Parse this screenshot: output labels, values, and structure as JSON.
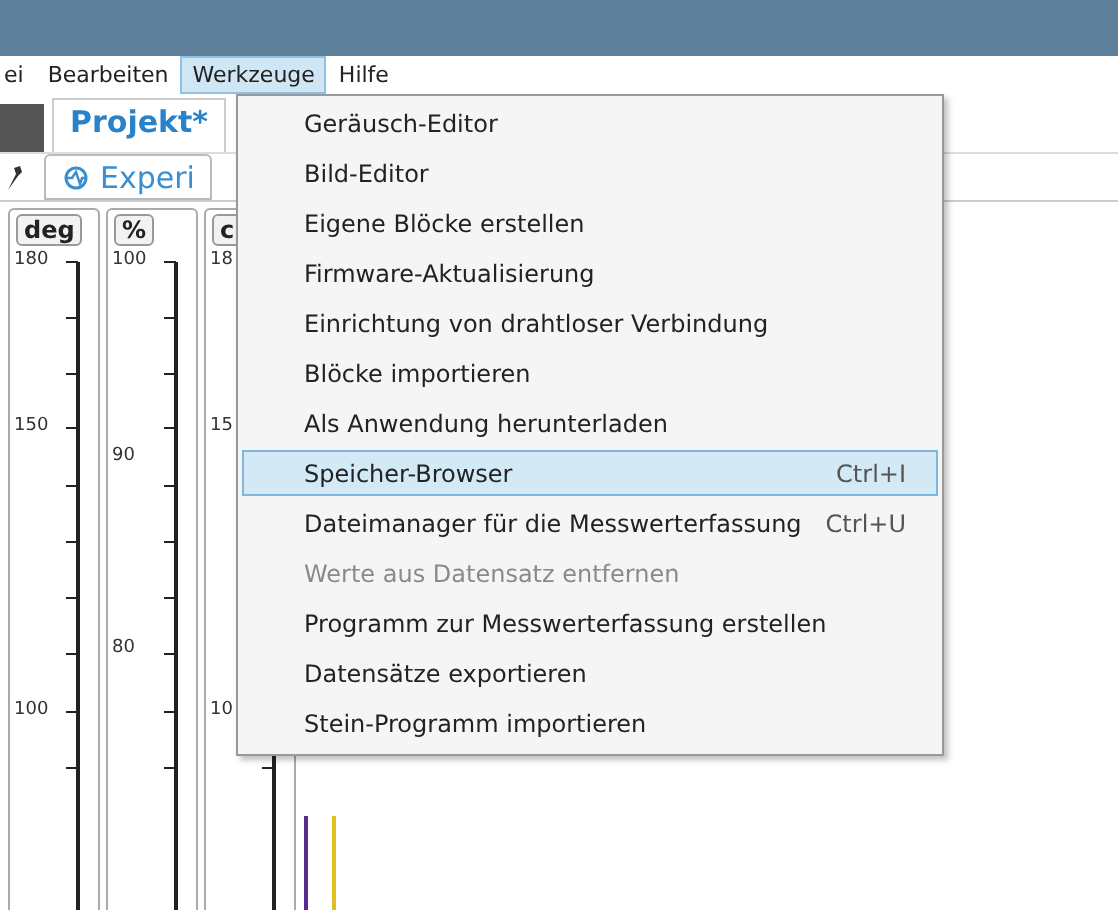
{
  "menu_bar": [
    {
      "label": "ei",
      "selected": false
    },
    {
      "label": "Bearbeiten",
      "selected": false
    },
    {
      "label": "Werkzeuge",
      "selected": true
    },
    {
      "label": "Hilfe",
      "selected": false
    }
  ],
  "tabs": [
    {
      "label": "Projekt*",
      "selected": true
    }
  ],
  "toolbar": {
    "tab": "Experi"
  },
  "gauges": [
    {
      "unit": "deg",
      "labels": [
        "180",
        "150",
        "100"
      ]
    },
    {
      "unit": "%",
      "labels": [
        "100",
        "90",
        "80"
      ]
    },
    {
      "unit": "c",
      "labels": [
        "18",
        "15",
        "10"
      ]
    }
  ],
  "dropdown": [
    {
      "label": "Geräusch-Editor",
      "selected": false,
      "disabled": false
    },
    {
      "label": "Bild-Editor",
      "selected": false,
      "disabled": false
    },
    {
      "label": "Eigene Blöcke erstellen",
      "selected": false,
      "disabled": false
    },
    {
      "label": "Firmware-Aktualisierung",
      "selected": false,
      "disabled": false
    },
    {
      "label": "Einrichtung von drahtloser Verbindung",
      "selected": false,
      "disabled": false
    },
    {
      "label": "Blöcke importieren",
      "selected": false,
      "disabled": false
    },
    {
      "label": "Als Anwendung herunterladen",
      "selected": false,
      "disabled": false
    },
    {
      "label": "Speicher-Browser",
      "shortcut": "Ctrl+I",
      "selected": true,
      "disabled": false
    },
    {
      "label": "Dateimanager für die Messwerterfassung",
      "shortcut": "Ctrl+U",
      "selected": false,
      "disabled": false
    },
    {
      "label": "Werte aus Datensatz entfernen",
      "selected": false,
      "disabled": true
    },
    {
      "label": "Programm zur Messwerterfassung erstellen",
      "selected": false,
      "disabled": false
    },
    {
      "label": "Datensätze exportieren",
      "selected": false,
      "disabled": false
    },
    {
      "label": "Stein-Programm importieren",
      "selected": false,
      "disabled": false
    }
  ]
}
